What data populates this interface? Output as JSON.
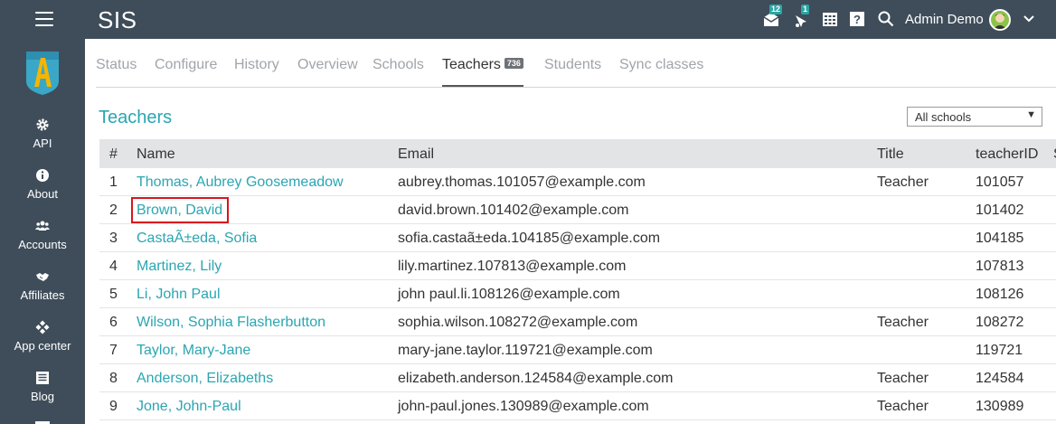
{
  "topbar": {
    "app_title": "SIS",
    "menu_icon": "hamburger-icon",
    "messages_count": "12",
    "notifications_count": "1",
    "user_name": "Admin Demo"
  },
  "sidebar": {
    "items": [
      {
        "label": "API",
        "icon": "gear-icon"
      },
      {
        "label": "About",
        "icon": "info-icon"
      },
      {
        "label": "Accounts",
        "icon": "users-icon"
      },
      {
        "label": "Affiliates",
        "icon": "handshake-icon"
      },
      {
        "label": "App center",
        "icon": "apps-icon"
      },
      {
        "label": "Blog",
        "icon": "blog-icon"
      }
    ]
  },
  "tabs": {
    "items": [
      {
        "label": "Status"
      },
      {
        "label": "Configure"
      },
      {
        "label": "History"
      },
      {
        "label": "Overview"
      },
      {
        "label": "Schools"
      },
      {
        "label": "Teachers",
        "badge": "736"
      },
      {
        "label": "Students"
      },
      {
        "label": "Sync classes"
      }
    ]
  },
  "section": {
    "title": "Teachers",
    "school_filter": "All schools"
  },
  "table": {
    "headers": {
      "num": "#",
      "name": "Name",
      "email": "Email",
      "title": "Title",
      "teacher_id": "teacherID",
      "extra": "S"
    },
    "rows": [
      {
        "num": "1",
        "name": "Thomas, Aubrey Goosemeadow",
        "email": "aubrey.thomas.101057@example.com",
        "title": "Teacher",
        "teacher_id": "101057"
      },
      {
        "num": "2",
        "name": "Brown, David",
        "email": "david.brown.101402@example.com",
        "title": "",
        "teacher_id": "101402"
      },
      {
        "num": "3",
        "name": "CastaÃ±eda, Sofia",
        "email": "sofia.castaã±eda.104185@example.com",
        "title": "",
        "teacher_id": "104185"
      },
      {
        "num": "4",
        "name": "Martinez, Lily",
        "email": "lily.martinez.107813@example.com",
        "title": "",
        "teacher_id": "107813"
      },
      {
        "num": "5",
        "name": "Li, John Paul",
        "email": "john paul.li.108126@example.com",
        "title": "",
        "teacher_id": "108126"
      },
      {
        "num": "6",
        "name": "Wilson, Sophia Flasherbutton",
        "email": "sophia.wilson.108272@example.com",
        "title": "Teacher",
        "teacher_id": "108272"
      },
      {
        "num": "7",
        "name": "Taylor, Mary-Jane",
        "email": "mary-jane.taylor.119721@example.com",
        "title": "",
        "teacher_id": "119721"
      },
      {
        "num": "8",
        "name": "Anderson, Elizabeths",
        "email": "elizabeth.anderson.124584@example.com",
        "title": "Teacher",
        "teacher_id": "124584"
      },
      {
        "num": "9",
        "name": "Jone, John-Paul",
        "email": "john-paul.jones.130989@example.com",
        "title": "Teacher",
        "teacher_id": "130989"
      }
    ]
  },
  "colors": {
    "nav_bg": "#3f4d5a",
    "accent": "#2aa6b2",
    "highlight_border": "#d7161d"
  }
}
